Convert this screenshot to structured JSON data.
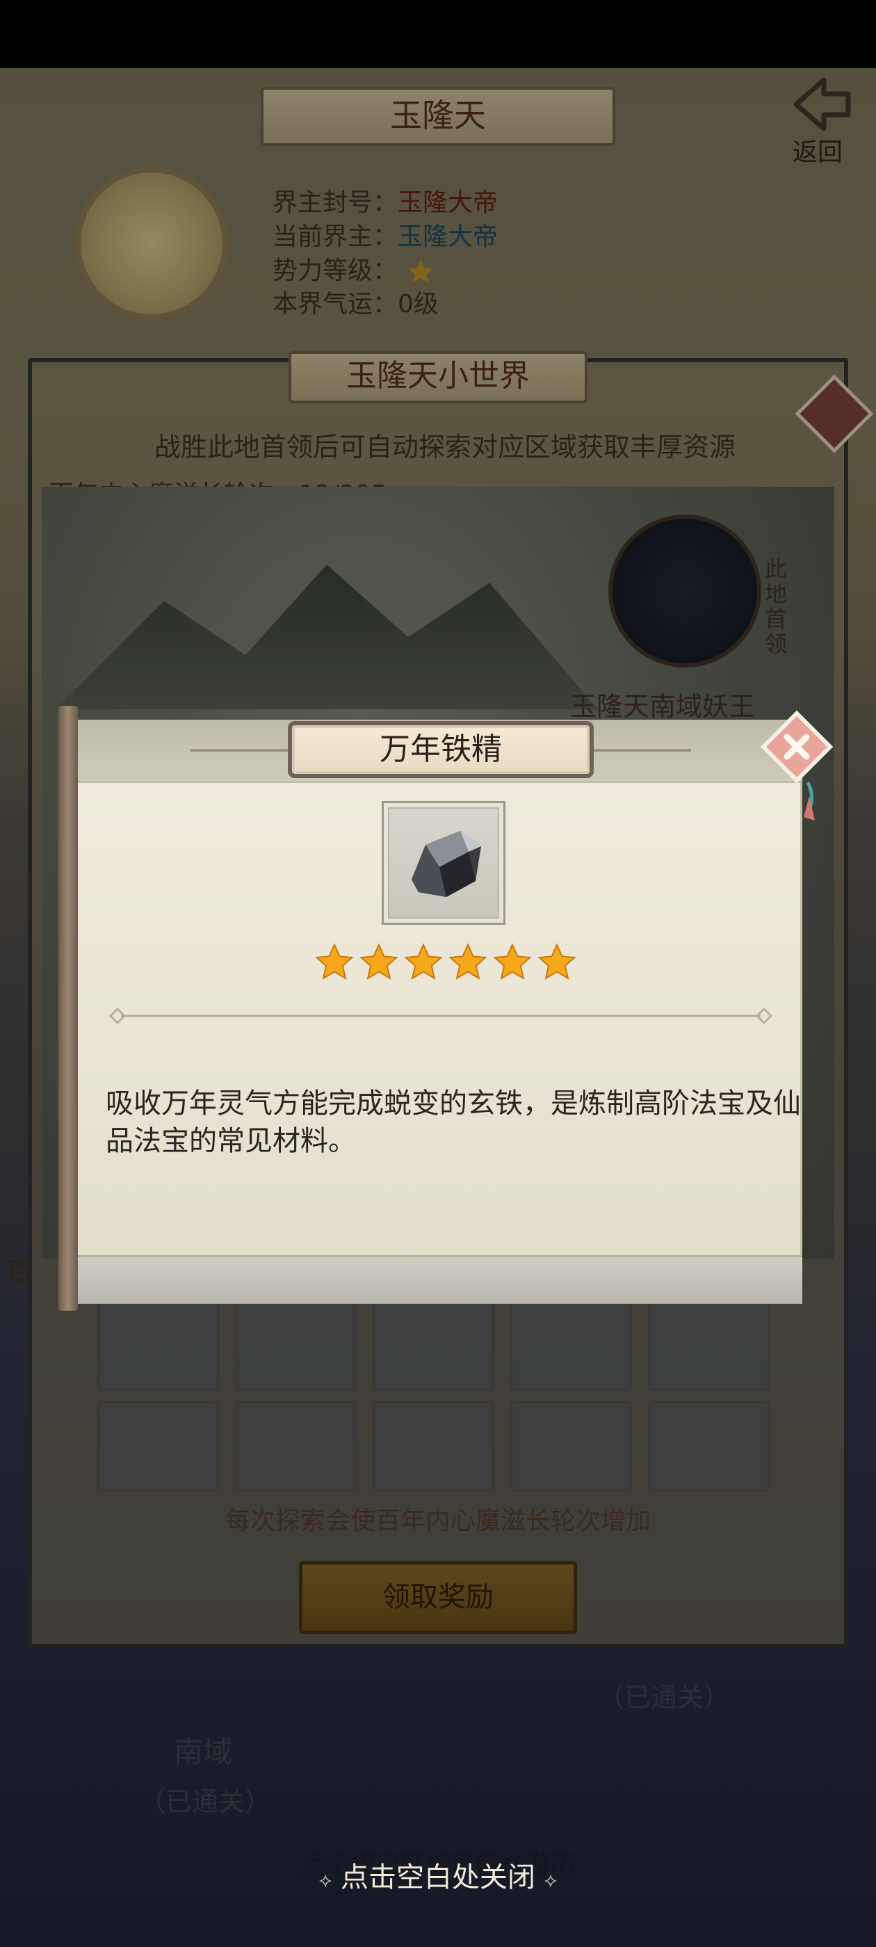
{
  "realm": {
    "title": "玉隆天",
    "back_label": "返回",
    "info": {
      "lord_title_label": "界主封号：",
      "lord_title_value": "玉隆大帝",
      "current_lord_label": "当前界主：",
      "current_lord_value": "玉隆大帝",
      "power_level_label": "势力等级：",
      "fortune_label": "本界气运：",
      "fortune_value": "0级"
    }
  },
  "world": {
    "title": "玉隆天小世界",
    "hint": "战胜此地首领后可自动探索对应区域获取丰厚资源",
    "progress_label": "百年内心魔滋长轮次：",
    "progress_value": "12/295",
    "boss_tag": "此地首领",
    "boss_name": "玉隆天南域妖王",
    "side_label": "百",
    "explore_note": "每次探索会使百年内心魔滋长轮次增加",
    "claim_button": "领取奖励"
  },
  "map": {
    "south_region": "南域",
    "south_status": "（已通关）",
    "other_status": "（已通关）",
    "hint": "点击相应区域可前往游历"
  },
  "modal": {
    "title": "万年铁精",
    "item_icon": "iron-ore-icon",
    "stars": 6,
    "description": "吸收万年灵气方能完成蜕变的玄铁，是炼制高阶法宝及仙品法宝的常见材料。",
    "close_hint": "点击空白处关闭"
  },
  "colors": {
    "star": "#f6a81c",
    "modal_bg": "#ece7d7",
    "lord_name_blue": "#18405a",
    "lord_name_red": "#5a1c12"
  }
}
